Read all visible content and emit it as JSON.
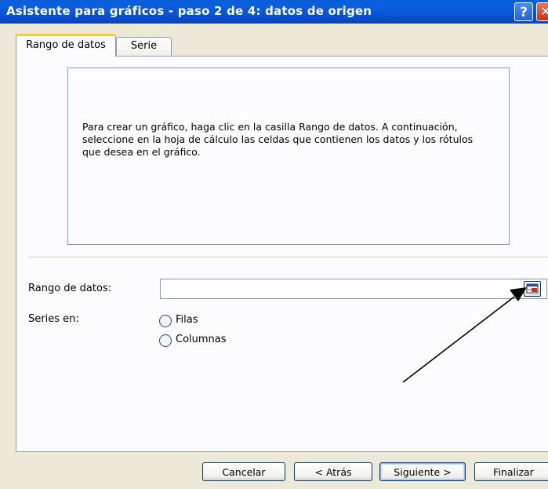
{
  "window": {
    "title": "Asistente para gráficos - paso 2 de 4: datos de origen",
    "help_glyph": "?",
    "close_glyph": "✕"
  },
  "tabs": [
    {
      "label": "Rango de datos",
      "active": true
    },
    {
      "label": "Serie",
      "active": false
    }
  ],
  "preview": {
    "instructions": "Para crear un gráfico, haga clic en la casilla Rango de datos. A continuación, seleccione en la hoja de cálculo las celdas que contienen los datos y los rótulos que desea en el gráfico."
  },
  "form": {
    "range_label": "Rango de datos:",
    "range_value": "",
    "series_label": "Series en:",
    "series_options": [
      {
        "label": "Filas",
        "selected": false
      },
      {
        "label": "Columnas",
        "selected": false
      }
    ],
    "collapse_icon": "collapse-dialog-icon"
  },
  "buttons": {
    "cancel": "Cancelar",
    "back": "< Atrás",
    "next": "Siguiente >",
    "finish": "Finalizar"
  },
  "colors": {
    "titlebar": "#0a5fd8",
    "tab_highlight": "#ffc83c",
    "button_border": "#003c74",
    "annotation_arrow": "#000000"
  }
}
